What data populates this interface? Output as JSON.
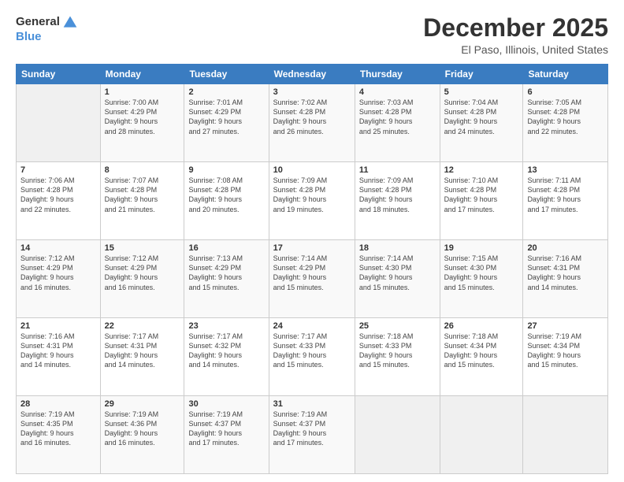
{
  "logo": {
    "general": "General",
    "blue": "Blue"
  },
  "header": {
    "month": "December 2025",
    "location": "El Paso, Illinois, United States"
  },
  "weekdays": [
    "Sunday",
    "Monday",
    "Tuesday",
    "Wednesday",
    "Thursday",
    "Friday",
    "Saturday"
  ],
  "weeks": [
    [
      {
        "day": "",
        "info": ""
      },
      {
        "day": "1",
        "info": "Sunrise: 7:00 AM\nSunset: 4:29 PM\nDaylight: 9 hours\nand 28 minutes."
      },
      {
        "day": "2",
        "info": "Sunrise: 7:01 AM\nSunset: 4:29 PM\nDaylight: 9 hours\nand 27 minutes."
      },
      {
        "day": "3",
        "info": "Sunrise: 7:02 AM\nSunset: 4:28 PM\nDaylight: 9 hours\nand 26 minutes."
      },
      {
        "day": "4",
        "info": "Sunrise: 7:03 AM\nSunset: 4:28 PM\nDaylight: 9 hours\nand 25 minutes."
      },
      {
        "day": "5",
        "info": "Sunrise: 7:04 AM\nSunset: 4:28 PM\nDaylight: 9 hours\nand 24 minutes."
      },
      {
        "day": "6",
        "info": "Sunrise: 7:05 AM\nSunset: 4:28 PM\nDaylight: 9 hours\nand 22 minutes."
      }
    ],
    [
      {
        "day": "7",
        "info": "Sunrise: 7:06 AM\nSunset: 4:28 PM\nDaylight: 9 hours\nand 22 minutes."
      },
      {
        "day": "8",
        "info": "Sunrise: 7:07 AM\nSunset: 4:28 PM\nDaylight: 9 hours\nand 21 minutes."
      },
      {
        "day": "9",
        "info": "Sunrise: 7:08 AM\nSunset: 4:28 PM\nDaylight: 9 hours\nand 20 minutes."
      },
      {
        "day": "10",
        "info": "Sunrise: 7:09 AM\nSunset: 4:28 PM\nDaylight: 9 hours\nand 19 minutes."
      },
      {
        "day": "11",
        "info": "Sunrise: 7:09 AM\nSunset: 4:28 PM\nDaylight: 9 hours\nand 18 minutes."
      },
      {
        "day": "12",
        "info": "Sunrise: 7:10 AM\nSunset: 4:28 PM\nDaylight: 9 hours\nand 17 minutes."
      },
      {
        "day": "13",
        "info": "Sunrise: 7:11 AM\nSunset: 4:28 PM\nDaylight: 9 hours\nand 17 minutes."
      }
    ],
    [
      {
        "day": "14",
        "info": "Sunrise: 7:12 AM\nSunset: 4:29 PM\nDaylight: 9 hours\nand 16 minutes."
      },
      {
        "day": "15",
        "info": "Sunrise: 7:12 AM\nSunset: 4:29 PM\nDaylight: 9 hours\nand 16 minutes."
      },
      {
        "day": "16",
        "info": "Sunrise: 7:13 AM\nSunset: 4:29 PM\nDaylight: 9 hours\nand 15 minutes."
      },
      {
        "day": "17",
        "info": "Sunrise: 7:14 AM\nSunset: 4:29 PM\nDaylight: 9 hours\nand 15 minutes."
      },
      {
        "day": "18",
        "info": "Sunrise: 7:14 AM\nSunset: 4:30 PM\nDaylight: 9 hours\nand 15 minutes."
      },
      {
        "day": "19",
        "info": "Sunrise: 7:15 AM\nSunset: 4:30 PM\nDaylight: 9 hours\nand 15 minutes."
      },
      {
        "day": "20",
        "info": "Sunrise: 7:16 AM\nSunset: 4:31 PM\nDaylight: 9 hours\nand 14 minutes."
      }
    ],
    [
      {
        "day": "21",
        "info": "Sunrise: 7:16 AM\nSunset: 4:31 PM\nDaylight: 9 hours\nand 14 minutes."
      },
      {
        "day": "22",
        "info": "Sunrise: 7:17 AM\nSunset: 4:31 PM\nDaylight: 9 hours\nand 14 minutes."
      },
      {
        "day": "23",
        "info": "Sunrise: 7:17 AM\nSunset: 4:32 PM\nDaylight: 9 hours\nand 14 minutes."
      },
      {
        "day": "24",
        "info": "Sunrise: 7:17 AM\nSunset: 4:33 PM\nDaylight: 9 hours\nand 15 minutes."
      },
      {
        "day": "25",
        "info": "Sunrise: 7:18 AM\nSunset: 4:33 PM\nDaylight: 9 hours\nand 15 minutes."
      },
      {
        "day": "26",
        "info": "Sunrise: 7:18 AM\nSunset: 4:34 PM\nDaylight: 9 hours\nand 15 minutes."
      },
      {
        "day": "27",
        "info": "Sunrise: 7:19 AM\nSunset: 4:34 PM\nDaylight: 9 hours\nand 15 minutes."
      }
    ],
    [
      {
        "day": "28",
        "info": "Sunrise: 7:19 AM\nSunset: 4:35 PM\nDaylight: 9 hours\nand 16 minutes."
      },
      {
        "day": "29",
        "info": "Sunrise: 7:19 AM\nSunset: 4:36 PM\nDaylight: 9 hours\nand 16 minutes."
      },
      {
        "day": "30",
        "info": "Sunrise: 7:19 AM\nSunset: 4:37 PM\nDaylight: 9 hours\nand 17 minutes."
      },
      {
        "day": "31",
        "info": "Sunrise: 7:19 AM\nSunset: 4:37 PM\nDaylight: 9 hours\nand 17 minutes."
      },
      {
        "day": "",
        "info": ""
      },
      {
        "day": "",
        "info": ""
      },
      {
        "day": "",
        "info": ""
      }
    ]
  ]
}
